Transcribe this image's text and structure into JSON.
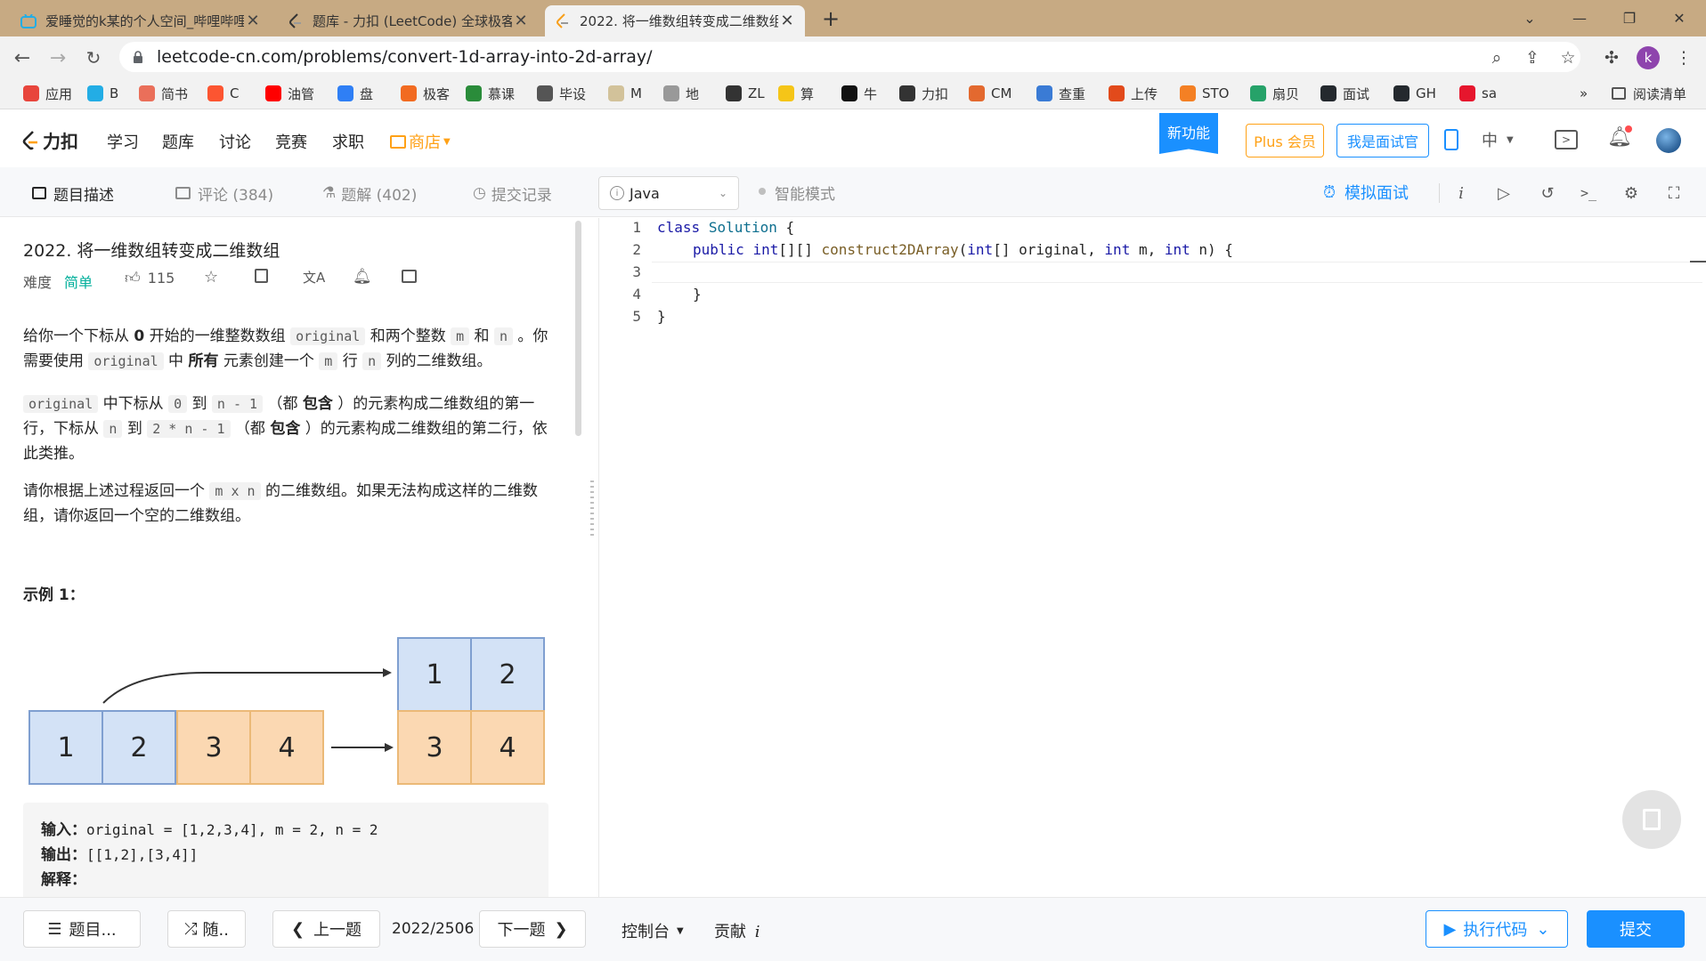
{
  "browser": {
    "tabs": [
      {
        "title": "爱睡觉的k某的个人空间_哔哩哔哩",
        "icon": "bilibili-icon",
        "active": false
      },
      {
        "title": "题库 - 力扣 (LeetCode) 全球极客",
        "icon": "leetcode-icon",
        "active": false
      },
      {
        "title": "2022. 将一维数组转变成二维数组",
        "icon": "leetcode-icon",
        "active": true
      }
    ],
    "new_tab": "+",
    "url": "leetcode-cn.com/problems/convert-1d-array-into-2d-array/",
    "profile_initial": "k",
    "bookmarks": [
      {
        "label": "应用",
        "color": "#e8453c"
      },
      {
        "label": "B",
        "color": "#23ade5"
      },
      {
        "label": "简书",
        "color": "#ea6f5a"
      },
      {
        "label": "C",
        "color": "#fc5531"
      },
      {
        "label": "油管",
        "color": "#ff0000"
      },
      {
        "label": "盘",
        "color": "#2f7ff5"
      },
      {
        "label": "极客",
        "color": "#f26b21"
      },
      {
        "label": "慕课",
        "color": "#2a8c3a"
      },
      {
        "label": "毕设",
        "color": "#555555"
      },
      {
        "label": "M",
        "color": "#d2c29a"
      },
      {
        "label": "地",
        "color": "#999999"
      },
      {
        "label": "ZL",
        "color": "#333333"
      },
      {
        "label": "算",
        "color": "#f5c518"
      },
      {
        "label": "牛",
        "color": "#111111"
      },
      {
        "label": "力扣",
        "color": "#333333"
      },
      {
        "label": "CM",
        "color": "#e3692f"
      },
      {
        "label": "查重",
        "color": "#3a7bd5"
      },
      {
        "label": "上传",
        "color": "#e24a1b"
      },
      {
        "label": "STO",
        "color": "#f48024"
      },
      {
        "label": "扇贝",
        "color": "#26a269"
      },
      {
        "label": "面试",
        "color": "#24292e"
      },
      {
        "label": "GH",
        "color": "#24292e"
      },
      {
        "label": "sa",
        "color": "#e6162d"
      }
    ],
    "bookmarks_more": "»",
    "reading_list": "阅读清单"
  },
  "lc_nav": {
    "logo_text": "力扣",
    "links": [
      "学习",
      "题库",
      "讨论",
      "竞赛",
      "求职"
    ],
    "store": "商店",
    "new_feature": "新功能",
    "plus": "Plus 会员",
    "interviewer": "我是面试官",
    "lang": "中",
    "accent_color": "#1a90ff",
    "store_color": "#ffa116"
  },
  "toolbar": {
    "tabs": [
      "题目描述",
      "评论 (384)",
      "题解 (402)",
      "提交记录"
    ],
    "language": "Java",
    "smart_mode": "智能模式",
    "mock_interview": "模拟面试",
    "info_label": "i"
  },
  "problem": {
    "title": "2022. 将一维数组转变成二维数组",
    "difficulty_label": "难度",
    "difficulty": "简单",
    "difficulty_color": "#00af9b",
    "likes": "115",
    "p1": {
      "a": "给你一个下标从 ",
      "b": "0",
      "c": " 开始的一维整数数组 ",
      "code1": "original",
      "d": " 和两个整数 ",
      "code2": "m",
      "e": " 和 ",
      "code3": "n",
      "f": " 。你需要使用 ",
      "code4": "original",
      "g": " 中 ",
      "h": "所有",
      "i": " 元素创建一个 ",
      "code5": "m",
      "j": " 行 ",
      "code6": "n",
      "k": " 列的二维数组。"
    },
    "p2": {
      "code1": "original",
      "a": " 中下标从 ",
      "code2": "0",
      "b": " 到 ",
      "code3": "n - 1",
      "c": " （都 ",
      "d": "包含",
      "e": " ）的元素构成二维数组的第一行，下标从 ",
      "code4": "n",
      "f": " 到 ",
      "code5": "2 * n - 1",
      "g": " （都 ",
      "h": "包含",
      "i": " ）的元素构成二维数组的第二行，依此类推。"
    },
    "p3": {
      "a": "请你根据上述过程返回一个 ",
      "code1": "m x n",
      "b": " 的二维数组。如果无法构成这样的二维数组，请你返回一个空的二维数组。"
    },
    "example_title": "示例 1：",
    "diagram": {
      "row": [
        "1",
        "2",
        "3",
        "4"
      ],
      "grid": [
        "1",
        "2",
        "3",
        "4"
      ]
    },
    "example": {
      "input_label": "输入：",
      "input": "original = [1,2,3,4], m = 2, n = 2",
      "output_label": "输出：",
      "output": "[[1,2],[3,4]]",
      "explain_label": "解释："
    }
  },
  "code": {
    "line_numbers": [
      "1",
      "2",
      "3",
      "4",
      "5"
    ],
    "l1_kw": "class",
    "l1_cls": "Solution",
    "l1_rest": " {",
    "l2_kw": "public",
    "l2_type": "int",
    "l2_brackets": "[][] ",
    "l2_fn": "construct2DArray",
    "l2_p1": "(",
    "l2_t1": "int",
    "l2_p2": "[] original, ",
    "l2_t2": "int",
    "l2_p3": " m, ",
    "l2_t3": "int",
    "l2_p4": " n) {",
    "l4": "}",
    "l5": "}"
  },
  "bottom": {
    "problem_list": "题目...",
    "random": "随..",
    "prev": "上一题",
    "counter": "2022/2506",
    "next": "下一题",
    "console": "控制台",
    "contribute": "贡献",
    "contribute_i": "i",
    "run": "执行代码",
    "submit": "提交"
  }
}
